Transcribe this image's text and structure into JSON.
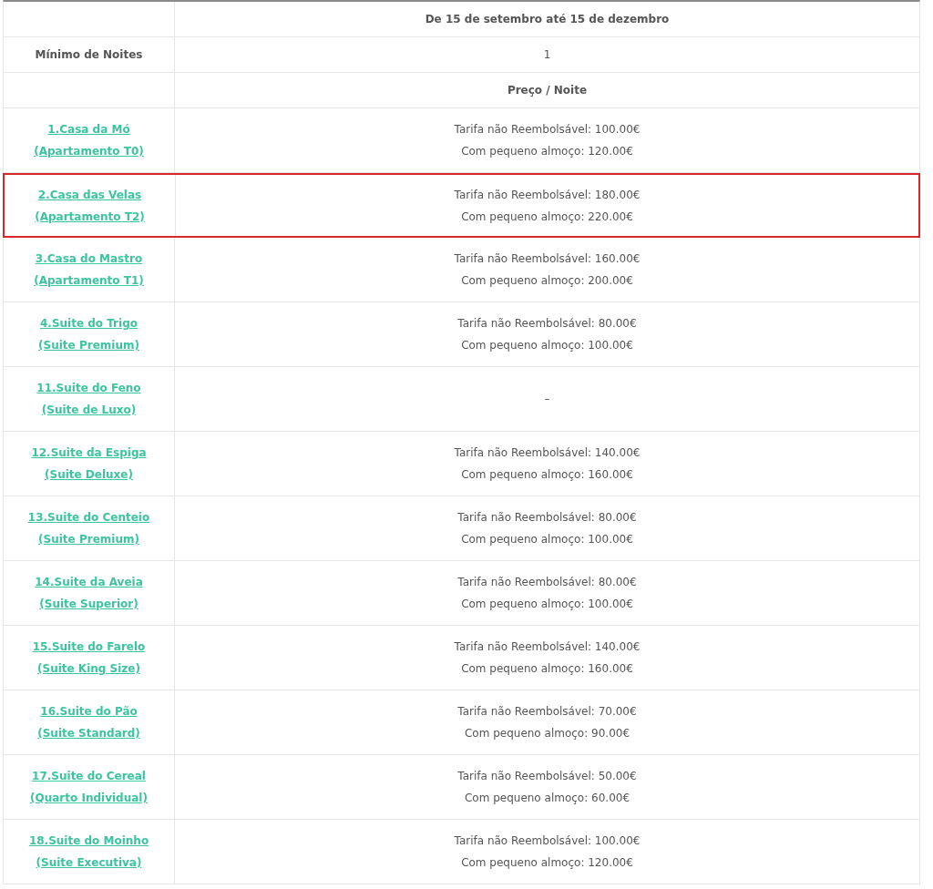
{
  "table": {
    "header_rows": [
      {
        "label": "",
        "value": "De 15 de setembro até 15 de dezembro",
        "bold_value": true
      },
      {
        "label": "Mínimo de Noites",
        "value": "1",
        "bold_value": false
      },
      {
        "label": "",
        "value": "Preço / Noite",
        "bold_value": true
      }
    ],
    "rows": [
      {
        "name": "1.Casa da Mó",
        "type": "(Apartamento T0)",
        "prices": [
          "Tarifa não Reembolsável: 100.00€",
          "Com pequeno almoço: 120.00€"
        ],
        "highlighted": false
      },
      {
        "name": "2.Casa das Velas",
        "type": "(Apartamento T2)",
        "prices": [
          "Tarifa não Reembolsável: 180.00€",
          "Com pequeno almoço: 220.00€"
        ],
        "highlighted": true
      },
      {
        "name": "3.Casa do Mastro",
        "type": "(Apartamento T1)",
        "prices": [
          "Tarifa não Reembolsável: 160.00€",
          "Com pequeno almoço: 200.00€"
        ],
        "highlighted": false
      },
      {
        "name": "4.Suite do Trigo",
        "type": "(Suite Premium)",
        "prices": [
          "Tarifa não Reembolsável: 80.00€",
          "Com pequeno almoço: 100.00€"
        ],
        "highlighted": false
      },
      {
        "name": "11.Suite do Feno",
        "type": "(Suite de Luxo)",
        "prices": [
          "–"
        ],
        "highlighted": false
      },
      {
        "name": "12.Suite da Espiga",
        "type": "(Suite Deluxe)",
        "prices": [
          "Tarifa não Reembolsável: 140.00€",
          "Com pequeno almoço: 160.00€"
        ],
        "highlighted": false
      },
      {
        "name": "13.Suite do Centeio",
        "type": "(Suite Premium)",
        "prices": [
          "Tarifa não Reembolsável: 80.00€",
          "Com pequeno almoço: 100.00€"
        ],
        "highlighted": false
      },
      {
        "name": "14.Suite da Aveia",
        "type": "(Suite Superior)",
        "prices": [
          "Tarifa não Reembolsável: 80.00€",
          "Com pequeno almoço: 100.00€"
        ],
        "highlighted": false
      },
      {
        "name": "15.Suite do Farelo",
        "type": "(Suite King Size)",
        "prices": [
          "Tarifa não Reembolsável: 140.00€",
          "Com pequeno almoço: 160.00€"
        ],
        "highlighted": false
      },
      {
        "name": "16.Suite do Pão",
        "type": "(Suite Standard)",
        "prices": [
          "Tarifa não Reembolsável: 70.00€",
          "Com pequeno almoço: 90.00€"
        ],
        "highlighted": false
      },
      {
        "name": "17.Suite do Cereal",
        "type": "(Quarto Individual)",
        "prices": [
          "Tarifa não Reembolsável: 50.00€",
          "Com pequeno almoço: 60.00€"
        ],
        "highlighted": false
      },
      {
        "name": "18.Suite do Moinho",
        "type": "(Suite Executiva)",
        "prices": [
          "Tarifa não Reembolsável: 100.00€",
          "Com pequeno almoço: 120.00€"
        ],
        "highlighted": false
      }
    ]
  }
}
